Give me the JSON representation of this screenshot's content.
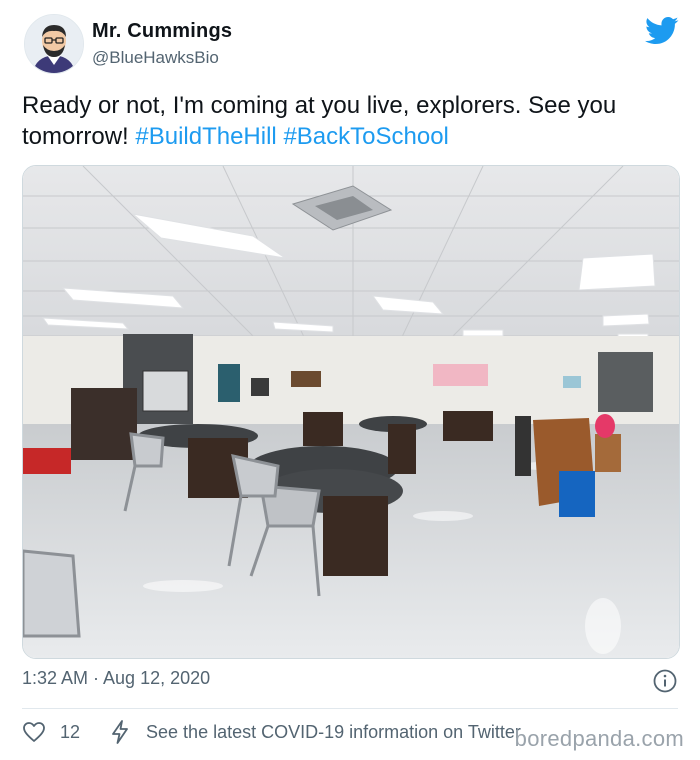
{
  "author": {
    "name": "Mr. Cummings",
    "handle": "@BlueHawksBio"
  },
  "tweet": {
    "text_main": "Ready or not, I'm coming at you live, explorers. See you tomorrow! ",
    "hashtags": [
      "#BuildTheHill",
      "#BackToSchool"
    ],
    "timestamp": "1:32 AM · Aug 12, 2020"
  },
  "photo": {
    "subject": "classroom-lab"
  },
  "footer": {
    "like_count": "12",
    "covid_link": "See the latest COVID-19 information on Twitter"
  },
  "watermark": "boredpanda.com",
  "icons": {
    "bird": "twitter-bird-icon",
    "info": "info-icon",
    "heart": "heart-icon",
    "bolt": "lightning-icon"
  },
  "colors": {
    "brand": "#1d9bf0",
    "text": "#0f1419",
    "muted": "#536471"
  }
}
